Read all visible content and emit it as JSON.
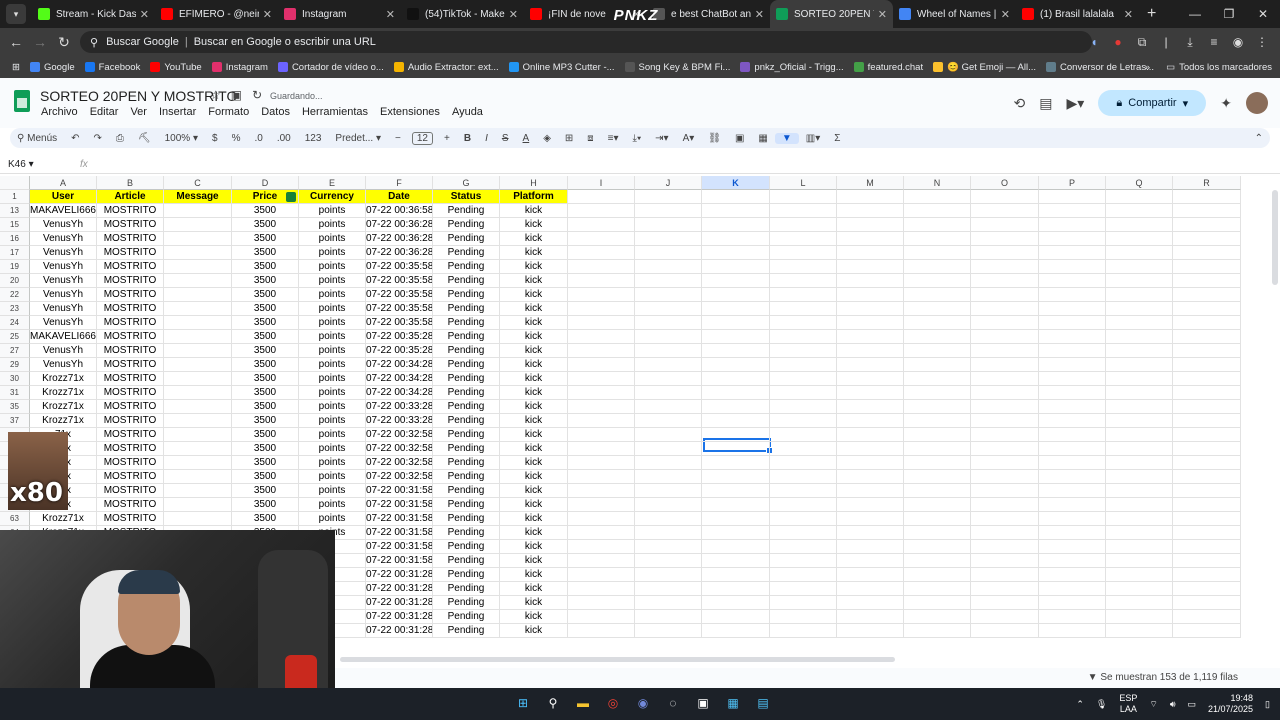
{
  "browser": {
    "tabs": [
      {
        "title": "Stream - Kick Dashbo",
        "color": "#53fc18",
        "active": false
      },
      {
        "title": "EFÍMERO - @neiram",
        "color": "#ff0000",
        "active": false
      },
      {
        "title": "Instagram",
        "color": "#e1306c",
        "active": false
      },
      {
        "title": "(54)TikTok - Make Yo",
        "color": "#111111",
        "active": false
      },
      {
        "title": "¡FIN de nove",
        "color": "#ff0000",
        "active": false
      },
      {
        "title": "e best ChatBot and",
        "color": "#555555",
        "active": false
      },
      {
        "title": "SORTEO 20PEN Y MO",
        "color": "#0f9d58",
        "active": true
      },
      {
        "title": "Wheel of Names | Se",
        "color": "#4285f4",
        "active": false
      },
      {
        "title": "(1) Brasil lalalala",
        "color": "#ff0000",
        "active": false
      }
    ],
    "overlay_logo": "PNKZ",
    "address_label": "Buscar Google",
    "address_placeholder": "Buscar en Google o escribir una URL",
    "bookmarks": [
      {
        "label": "Google",
        "color": "#4285f4"
      },
      {
        "label": "Facebook",
        "color": "#1877f2"
      },
      {
        "label": "YouTube",
        "color": "#ff0000"
      },
      {
        "label": "Instagram",
        "color": "#e1306c"
      },
      {
        "label": "Cortador de vídeo o...",
        "color": "#6c63ff"
      },
      {
        "label": "Audio Extractor: ext...",
        "color": "#f4b400"
      },
      {
        "label": "Online MP3 Cutter -...",
        "color": "#2196f3"
      },
      {
        "label": "Song Key & BPM Fi...",
        "color": "#555555"
      },
      {
        "label": "pnkz_Oficial - Trigg...",
        "color": "#7e57c2"
      },
      {
        "label": "featured.chat",
        "color": "#43a047"
      },
      {
        "label": "😊 Get Emoji — All...",
        "color": "#fbc02d"
      },
      {
        "label": "Conversor de Letras...",
        "color": "#607d8b"
      }
    ],
    "all_bookmarks": "Todos los marcadores"
  },
  "sheets": {
    "title": "SORTEO 20PEN Y MOSTRITO",
    "saving": "Guardando...",
    "menus": [
      "Archivo",
      "Editar",
      "Ver",
      "Insertar",
      "Formato",
      "Datos",
      "Herramientas",
      "Extensiones",
      "Ayuda"
    ],
    "share_label": "Compartir",
    "toolbar": {
      "search": "Menús",
      "zoom": "100%",
      "currency": "$",
      "percent": "%",
      "dec_less": ".0",
      "dec_more": ".00",
      "numfmt": "123",
      "font": "Predet...",
      "font_size": "12"
    },
    "name_box": "K46",
    "fx": "fx",
    "columns": [
      "A",
      "B",
      "C",
      "D",
      "E",
      "F",
      "G",
      "H",
      "I",
      "J",
      "K",
      "L",
      "M",
      "N",
      "O",
      "P",
      "Q",
      "R"
    ],
    "headers": [
      "User",
      "Article",
      "Message",
      "Price",
      "Currency",
      "Date",
      "Status",
      "Platform"
    ],
    "header_row": "1",
    "rows": [
      [
        "13",
        "MAKAVELI666",
        "MOSTRITO",
        "",
        "3500",
        "points",
        "07-22 00:36:58",
        "Pending",
        "kick"
      ],
      [
        "15",
        "VenusYh",
        "MOSTRITO",
        "",
        "3500",
        "points",
        "07-22 00:36:28",
        "Pending",
        "kick"
      ],
      [
        "16",
        "VenusYh",
        "MOSTRITO",
        "",
        "3500",
        "points",
        "07-22 00:36:28",
        "Pending",
        "kick"
      ],
      [
        "17",
        "VenusYh",
        "MOSTRITO",
        "",
        "3500",
        "points",
        "07-22 00:36:28",
        "Pending",
        "kick"
      ],
      [
        "19",
        "VenusYh",
        "MOSTRITO",
        "",
        "3500",
        "points",
        "07-22 00:35:58",
        "Pending",
        "kick"
      ],
      [
        "20",
        "VenusYh",
        "MOSTRITO",
        "",
        "3500",
        "points",
        "07-22 00:35:58",
        "Pending",
        "kick"
      ],
      [
        "22",
        "VenusYh",
        "MOSTRITO",
        "",
        "3500",
        "points",
        "07-22 00:35:58",
        "Pending",
        "kick"
      ],
      [
        "23",
        "VenusYh",
        "MOSTRITO",
        "",
        "3500",
        "points",
        "07-22 00:35:58",
        "Pending",
        "kick"
      ],
      [
        "24",
        "VenusYh",
        "MOSTRITO",
        "",
        "3500",
        "points",
        "07-22 00:35:58",
        "Pending",
        "kick"
      ],
      [
        "25",
        "MAKAVELI666",
        "MOSTRITO",
        "",
        "3500",
        "points",
        "07-22 00:35:28",
        "Pending",
        "kick"
      ],
      [
        "27",
        "VenusYh",
        "MOSTRITO",
        "",
        "3500",
        "points",
        "07-22 00:35:28",
        "Pending",
        "kick"
      ],
      [
        "29",
        "VenusYh",
        "MOSTRITO",
        "",
        "3500",
        "points",
        "07-22 00:34:28",
        "Pending",
        "kick"
      ],
      [
        "30",
        "Krozz71x",
        "MOSTRITO",
        "",
        "3500",
        "points",
        "07-22 00:34:28",
        "Pending",
        "kick"
      ],
      [
        "31",
        "Krozz71x",
        "MOSTRITO",
        "",
        "3500",
        "points",
        "07-22 00:34:28",
        "Pending",
        "kick"
      ],
      [
        "35",
        "Krozz71x",
        "MOSTRITO",
        "",
        "3500",
        "points",
        "07-22 00:33:28",
        "Pending",
        "kick"
      ],
      [
        "37",
        "Krozz71x",
        "MOSTRITO",
        "",
        "3500",
        "points",
        "07-22 00:33:28",
        "Pending",
        "kick"
      ],
      [
        "",
        "71x",
        "MOSTRITO",
        "",
        "3500",
        "points",
        "07-22 00:32:58",
        "Pending",
        "kick"
      ],
      [
        "",
        "71x",
        "MOSTRITO",
        "",
        "3500",
        "points",
        "07-22 00:32:58",
        "Pending",
        "kick"
      ],
      [
        "",
        "71x",
        "MOSTRITO",
        "",
        "3500",
        "points",
        "07-22 00:32:58",
        "Pending",
        "kick"
      ],
      [
        "",
        "71x",
        "MOSTRITO",
        "",
        "3500",
        "points",
        "07-22 00:32:58",
        "Pending",
        "kick"
      ],
      [
        "",
        "71x",
        "MOSTRITO",
        "",
        "3500",
        "points",
        "07-22 00:31:58",
        "Pending",
        "kick"
      ],
      [
        "",
        "71x",
        "MOSTRITO",
        "",
        "3500",
        "points",
        "07-22 00:31:58",
        "Pending",
        "kick"
      ],
      [
        "63",
        "Krozz71x",
        "MOSTRITO",
        "",
        "3500",
        "points",
        "07-22 00:31:58",
        "Pending",
        "kick"
      ],
      [
        "64",
        "Krozz71x",
        "MOSTRITO",
        "",
        "3500",
        "points",
        "07-22 00:31:58",
        "Pending",
        "kick"
      ],
      [
        "",
        "",
        "",
        "",
        "",
        "",
        "07-22 00:31:58",
        "Pending",
        "kick"
      ],
      [
        "",
        "",
        "",
        "",
        "",
        "",
        "07-22 00:31:58",
        "Pending",
        "kick"
      ],
      [
        "",
        "",
        "",
        "",
        "",
        "",
        "07-22 00:31:28",
        "Pending",
        "kick"
      ],
      [
        "",
        "",
        "",
        "",
        "",
        "",
        "07-22 00:31:28",
        "Pending",
        "kick"
      ],
      [
        "",
        "",
        "",
        "",
        "",
        "",
        "07-22 00:31:28",
        "Pending",
        "kick"
      ],
      [
        "",
        "",
        "",
        "",
        "",
        "",
        "07-22 00:31:28",
        "Pending",
        "kick"
      ],
      [
        "",
        "",
        "",
        "",
        "",
        "",
        "07-22 00:31:28",
        "Pending",
        "kick"
      ]
    ],
    "row_count_label": "Se muestran 153 de 1,119 filas"
  },
  "stream_overlay": {
    "emote_label": "x80"
  },
  "taskbar": {
    "lang1": "ESP",
    "lang2": "LAA",
    "time": "19:48",
    "date": "21/07/2025"
  }
}
